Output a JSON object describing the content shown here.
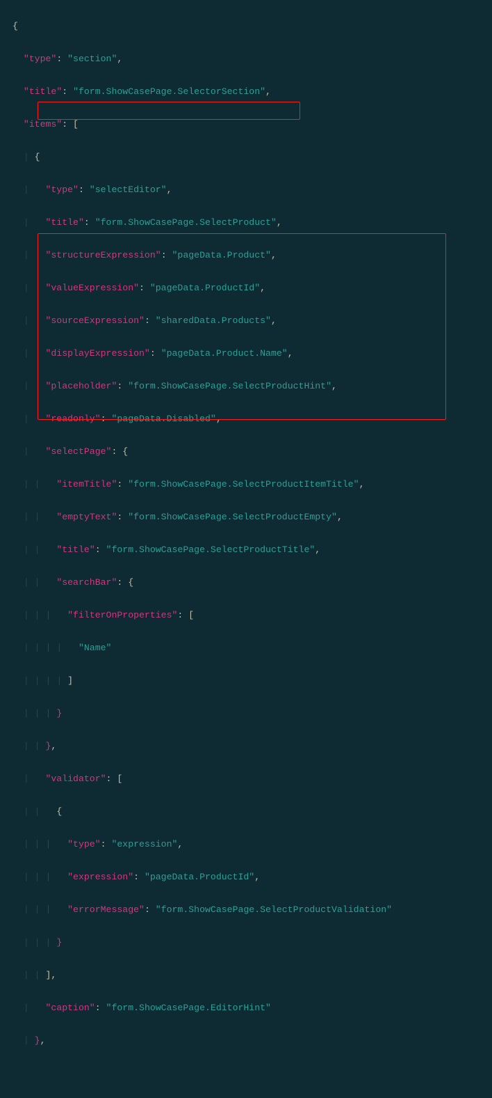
{
  "code_tokens": {
    "l1_brace_open": "{",
    "l2_key": "\"type\"",
    "l2_val": "\"section\"",
    "l3_key": "\"title\"",
    "l3_val": "\"form.ShowCasePage.SelectorSection\"",
    "l4_key": "\"items\"",
    "l7_key": "\"type\"",
    "l7_val": "\"selectEditor\"",
    "l8_key": "\"title\"",
    "l8_val": "\"form.ShowCasePage.SelectProduct\"",
    "l9_key": "\"structureExpression\"",
    "l9_val": "\"pageData.Product\"",
    "l10_key": "\"valueExpression\"",
    "l10_val": "\"pageData.ProductId\"",
    "l11_key": "\"sourceExpression\"",
    "l11_val": "\"sharedData.Products\"",
    "l12_key": "\"displayExpression\"",
    "l12_val": "\"pageData.Product.Name\"",
    "l13_key": "\"placeholder\"",
    "l13_val": "\"form.ShowCasePage.SelectProductHint\"",
    "l14_key": "\"readonly\"",
    "l14_val": "\"pageData.Disabled\"",
    "l15_key": "\"selectPage\"",
    "l16_key": "\"itemTitle\"",
    "l16_val": "\"form.ShowCasePage.SelectProductItemTitle\"",
    "l17_key": "\"emptyText\"",
    "l17_val": "\"form.ShowCasePage.SelectProductEmpty\"",
    "l18_key": "\"title\"",
    "l18_val": "\"form.ShowCasePage.SelectProductTitle\"",
    "l19_key": "\"searchBar\"",
    "l20_key": "\"filterOnProperties\"",
    "l21_val": "\"Name\"",
    "l26_key": "\"validator\"",
    "l28_key": "\"type\"",
    "l28_val": "\"expression\"",
    "l29_key": "\"expression\"",
    "l29_val": "\"pageData.ProductId\"",
    "l30_key": "\"errorMessage\"",
    "l30_val": "\"form.ShowCasePage.SelectProductValidation\"",
    "l33_key": "\"caption\"",
    "l33_val": "\"form.ShowCasePage.EditorHint\""
  },
  "colors": {
    "background": "#0e2a32",
    "key": "#d33682",
    "string": "#2aa198",
    "punc": "#c5bda3",
    "guide": "#254750",
    "highlight": "#ff1a1a"
  }
}
